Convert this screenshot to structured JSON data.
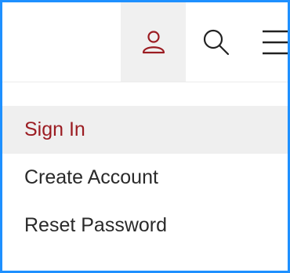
{
  "header": {
    "account_icon": "user-icon",
    "search_icon": "search-icon",
    "menu_icon": "hamburger-menu-icon"
  },
  "account_menu": {
    "items": [
      {
        "label": "Sign In",
        "active": true
      },
      {
        "label": "Create Account",
        "active": false
      },
      {
        "label": "Reset Password",
        "active": false
      }
    ]
  },
  "colors": {
    "accent": "#9b1c22",
    "border": "#1e90ff",
    "highlight_bg": "#efefef"
  }
}
